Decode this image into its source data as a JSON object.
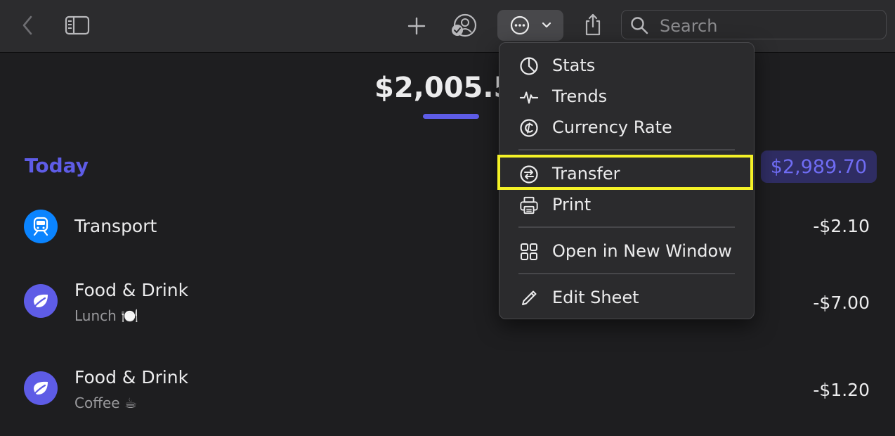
{
  "toolbar": {
    "back_icon": "chevron-left-icon",
    "sidebar_icon": "sidebar-toggle-icon",
    "add_icon": "plus-icon",
    "share_people_icon": "person-badge-icon",
    "more_icon": "ellipsis-circle-icon",
    "share_icon": "share-icon",
    "search_placeholder": "Search"
  },
  "summary": {
    "balance": "$2,005.5"
  },
  "section": {
    "title": "Today",
    "total": "$2,989.70"
  },
  "transactions": [
    {
      "category": "Transport",
      "note": "",
      "amount": "-$2.10",
      "icon": "train-icon",
      "color": "#0a84ff"
    },
    {
      "category": "Food & Drink",
      "note": "Lunch 🍽️",
      "amount": "-$7.00",
      "icon": "leaf-icon",
      "color": "#5e5ce6"
    },
    {
      "category": "Food & Drink",
      "note": "Coffee ☕",
      "amount": "-$1.20",
      "icon": "leaf-icon",
      "color": "#5e5ce6"
    }
  ],
  "menu": {
    "items": [
      {
        "label": "Stats",
        "icon": "pie-chart-icon"
      },
      {
        "label": "Trends",
        "icon": "waveform-icon"
      },
      {
        "label": "Currency Rate",
        "icon": "currency-circle-icon"
      },
      {
        "label": "Transfer",
        "icon": "transfer-arrows-icon"
      },
      {
        "label": "Print",
        "icon": "printer-icon"
      },
      {
        "label": "Open in New Window",
        "icon": "grid-window-icon"
      },
      {
        "label": "Edit Sheet",
        "icon": "pencil-icon"
      }
    ]
  },
  "colors": {
    "accent": "#5e5ce6",
    "highlight": "#f4f227",
    "background": "#1e1e20"
  }
}
